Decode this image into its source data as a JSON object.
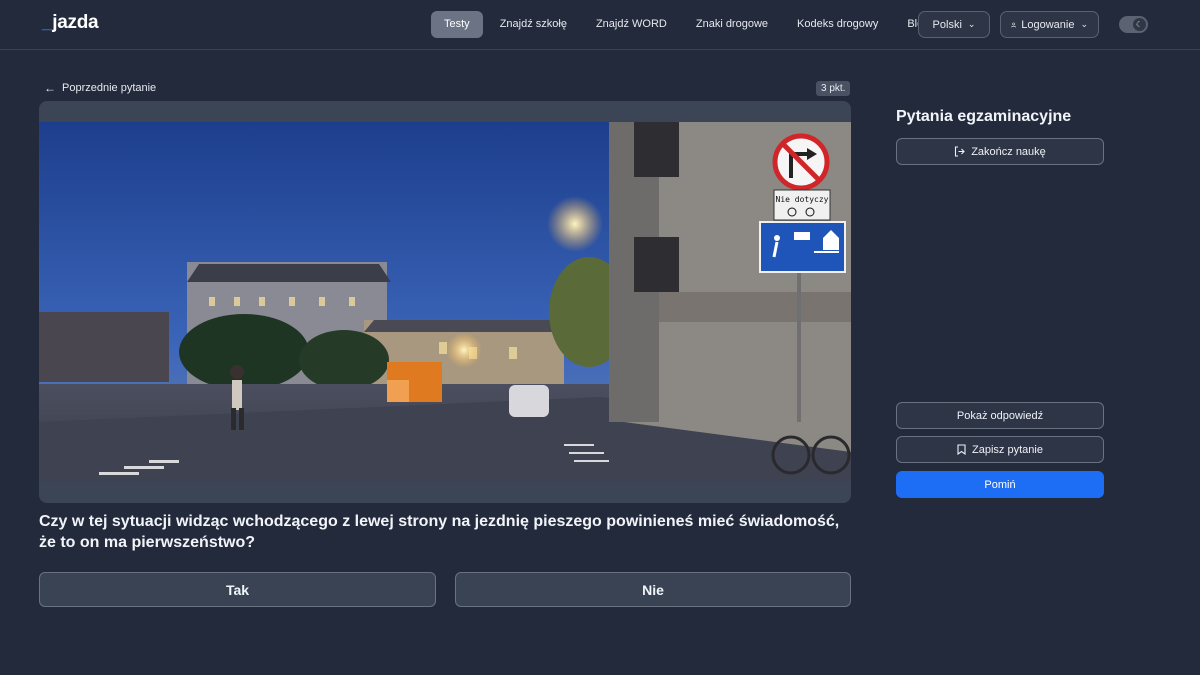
{
  "header": {
    "logo": "jazda",
    "nav": [
      {
        "label": "Testy",
        "active": true
      },
      {
        "label": "Znajdź szkołę",
        "active": false
      },
      {
        "label": "Znajdź WORD",
        "active": false
      },
      {
        "label": "Znaki drogowe",
        "active": false
      },
      {
        "label": "Kodeks drogowy",
        "active": false
      },
      {
        "label": "Blog",
        "active": false
      }
    ],
    "language": "Polski",
    "login": "Logowanie",
    "theme_toggle_icon": "moon-icon"
  },
  "question": {
    "prev_label": "Poprzednie pytanie",
    "points": "3 pkt.",
    "media_description_icon": "street-scene",
    "sign_text": "Nie dotyczy",
    "text": "Czy w tej sytuacji widząc wchodzącego z lewej strony na jezdnię pieszego powinieneś mieć świadomość, że to on ma pierwszeństwo?",
    "answers": {
      "yes": "Tak",
      "no": "Nie"
    }
  },
  "sidebar": {
    "title": "Pytania egzaminacyjne",
    "end_label": "Zakończ naukę",
    "show_label": "Pokaż odpowiedź",
    "save_label": "Zapisz pytanie",
    "skip_label": "Pomiń"
  },
  "colors": {
    "background": "#232a3b",
    "accent": "#1d6ef5",
    "active_nav": "#6b7384"
  }
}
